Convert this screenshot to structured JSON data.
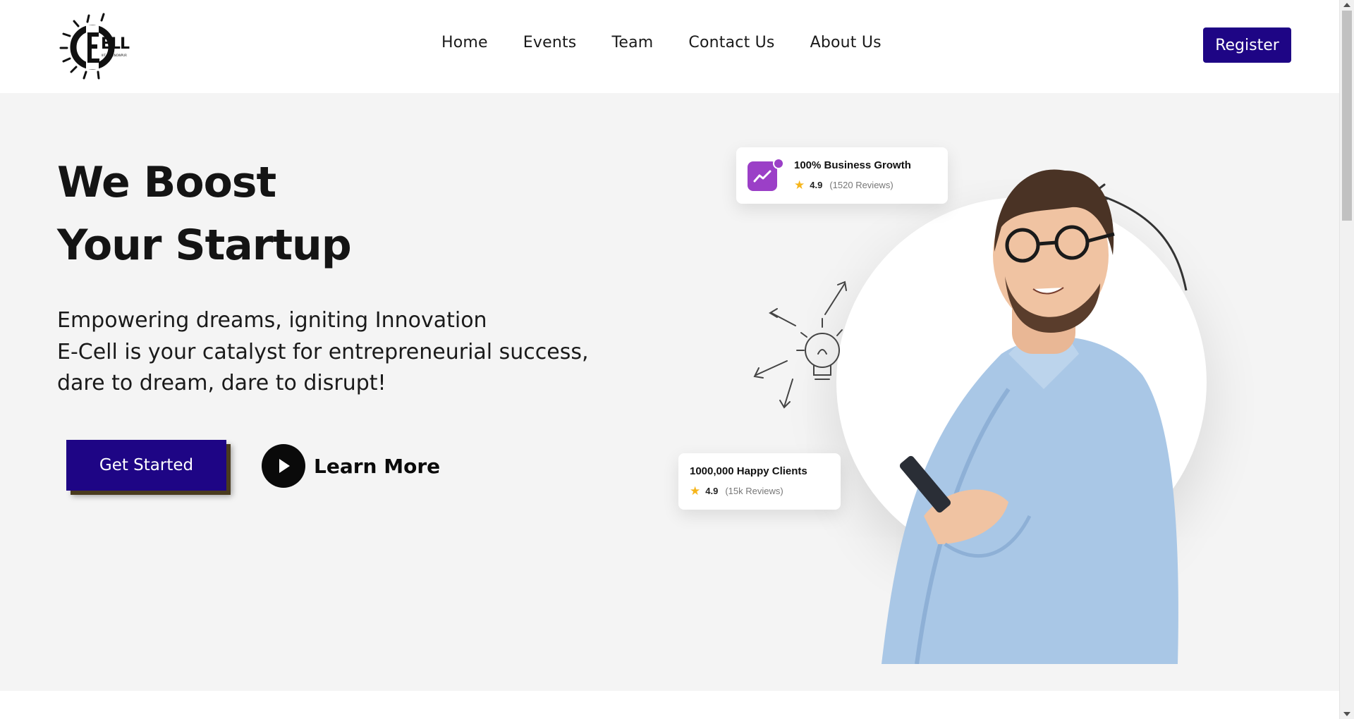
{
  "header": {
    "logo_text": "ELL",
    "logo_tagline": "IIIT LUCKNOWPUR",
    "nav": [
      "Home",
      "Events",
      "Team",
      "Contact Us",
      "About Us"
    ],
    "register_label": "Register"
  },
  "hero": {
    "title_line1": "We Boost",
    "title_line2": "Your Startup",
    "subtitle_line1": "Empowering dreams, igniting Innovation",
    "subtitle_line2": "E-Cell is your catalyst for entrepreneurial success,",
    "subtitle_line3": "dare to dream, dare to disrupt!",
    "get_started_label": "Get Started",
    "learn_more_label": "Learn More"
  },
  "cards": {
    "growth": {
      "title": "100% Business Growth",
      "rating": "4.9",
      "reviews": "(1520 Reviews)"
    },
    "clients": {
      "title": "1000,000 Happy Clients",
      "rating": "4.9",
      "reviews": "(15k Reviews)"
    }
  },
  "colors": {
    "accent": "#1e0585",
    "hero_bg": "#f4f4f4",
    "card_icon": "#9b3fc7",
    "star": "#f6b51b"
  }
}
